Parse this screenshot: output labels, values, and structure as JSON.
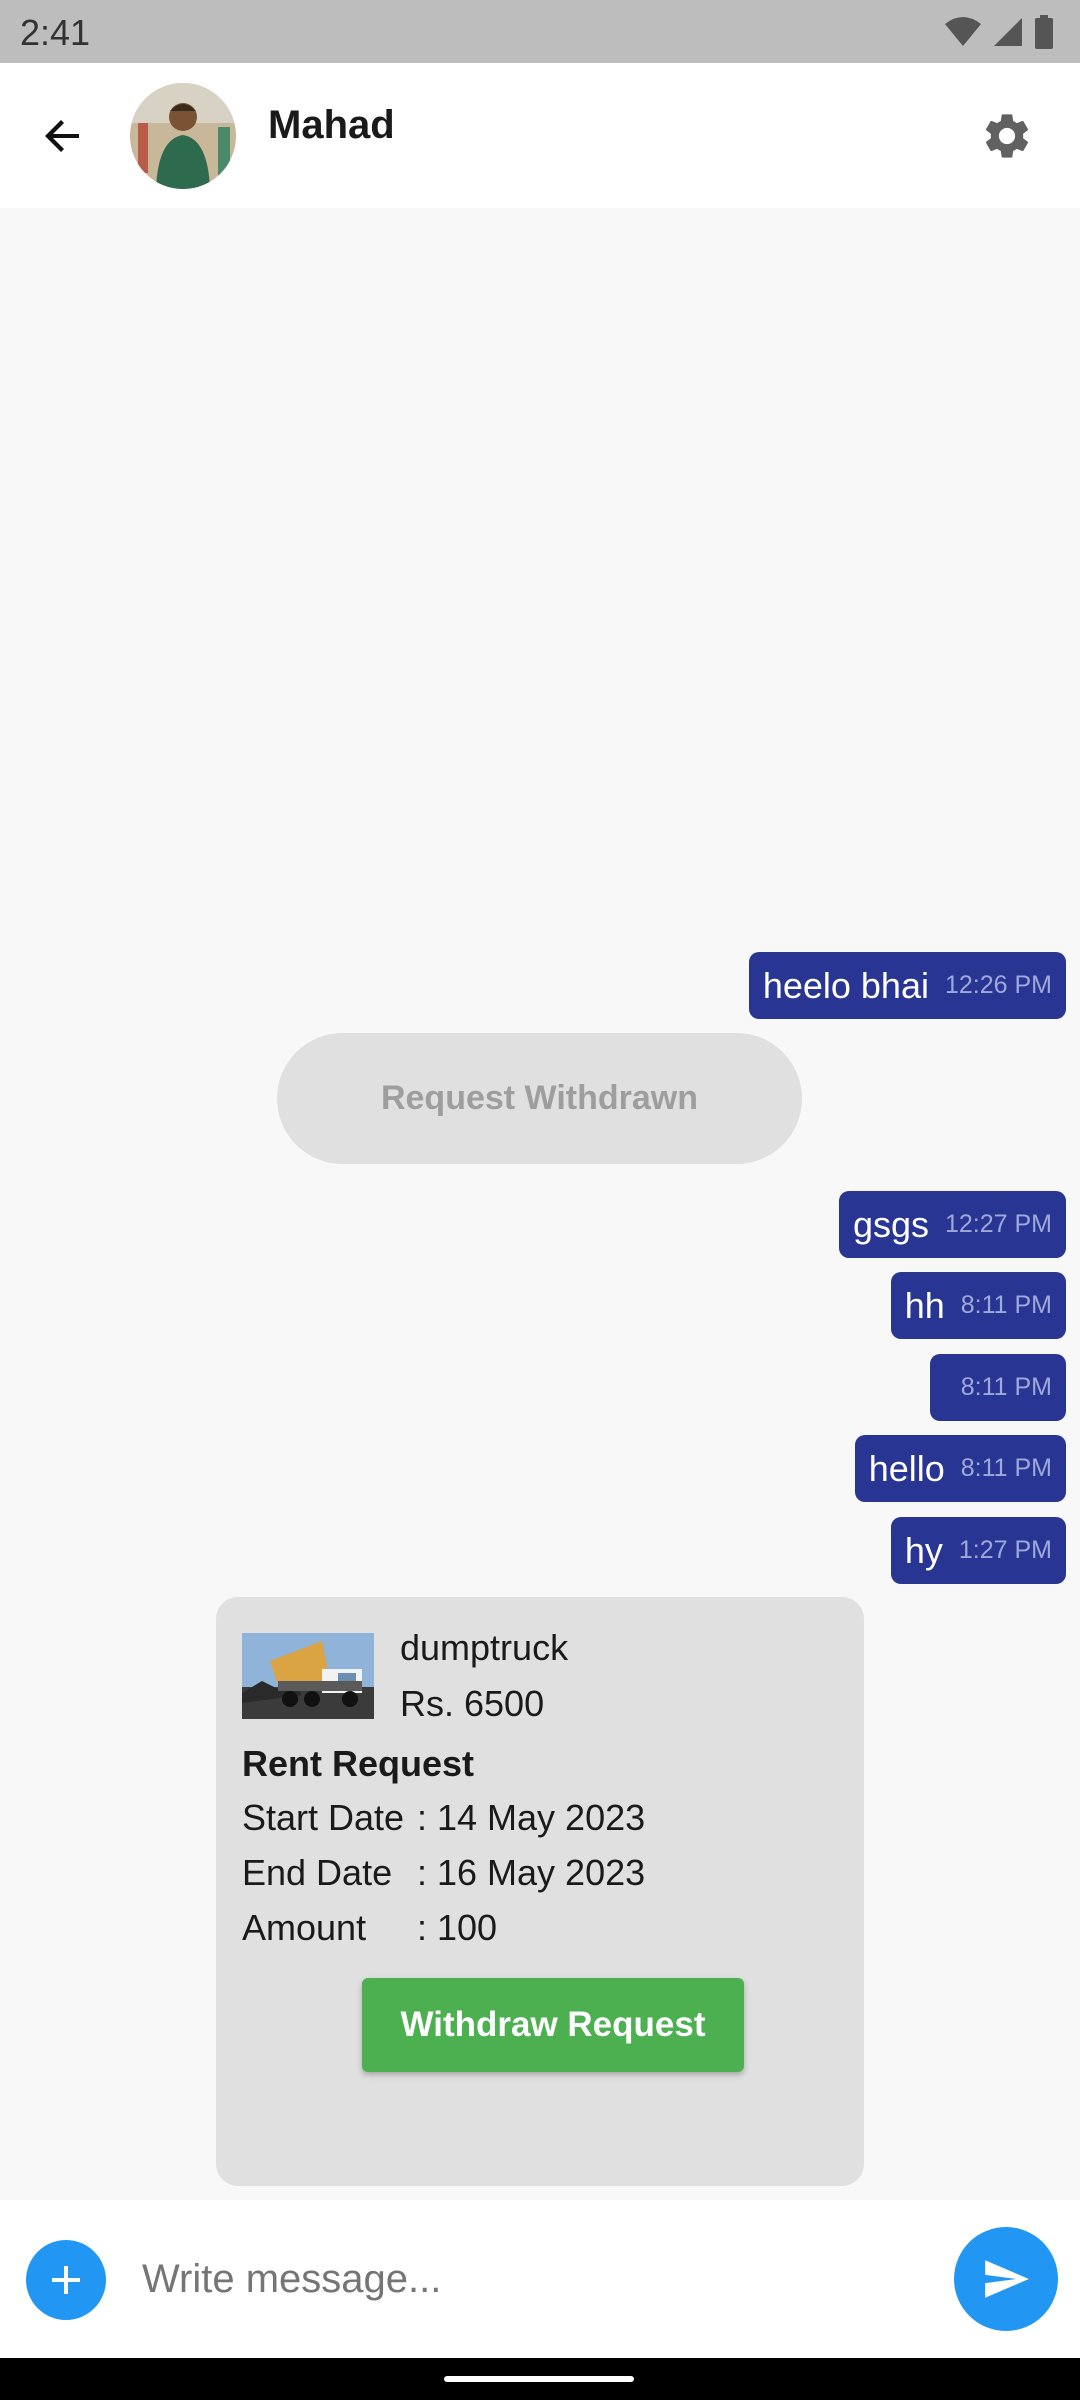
{
  "status_bar": {
    "time": "2:41"
  },
  "header": {
    "contact_name": "Mahad"
  },
  "messages": [
    {
      "text": "heelo bhai",
      "time": "12:26 PM"
    },
    {
      "text": "gsgs",
      "time": "12:27 PM"
    },
    {
      "text": "hh",
      "time": "8:11 PM"
    },
    {
      "text": "",
      "time": "8:11 PM"
    },
    {
      "text": "hello",
      "time": "8:11 PM"
    },
    {
      "text": "hy",
      "time": "1:27 PM"
    }
  ],
  "system_notice": "Request Withdrawn",
  "rent_card": {
    "item_name": "dumptruck",
    "price": "Rs. 6500",
    "heading": "Rent Request",
    "start_label": "Start Date",
    "start_value": ": 14 May 2023",
    "end_label": "End Date",
    "end_value": ": 16 May 2023",
    "amount_label": "Amount",
    "amount_value": ": 100",
    "button_label": "Withdraw Request"
  },
  "composer": {
    "placeholder": "Write message..."
  },
  "colors": {
    "bubble": "#283593",
    "accent": "#2196f3",
    "withdraw_button": "#4caf50"
  }
}
